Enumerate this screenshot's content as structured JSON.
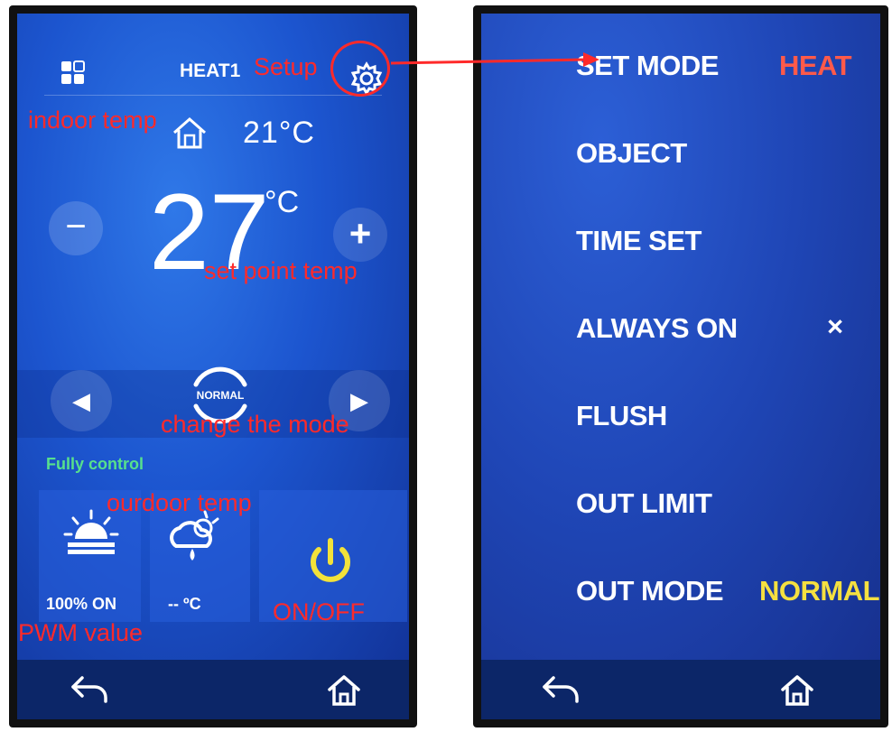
{
  "left_screen": {
    "title": "HEAT1",
    "indoor_temp": "21°C",
    "setpoint": "27",
    "setpoint_unit": "°C",
    "minus_label": "−",
    "plus_label": "+",
    "prev_label": "◀",
    "next_label": "▶",
    "mode": "NORMAL",
    "control_status": "Fully control",
    "pwm_text": "100%  ON",
    "outdoor_text": "--  ºC",
    "icons": [
      "grid-icon",
      "gear-icon",
      "house-icon",
      "sun-icon",
      "cloud-rain-icon",
      "power-icon",
      "back-icon",
      "home-icon"
    ]
  },
  "right_screen": {
    "menu": [
      {
        "label": "SET MODE",
        "value": "HEAT"
      },
      {
        "label": "OBJECT",
        "value": ""
      },
      {
        "label": "TIME SET",
        "value": ""
      },
      {
        "label": "ALWAYS ON",
        "value": "×"
      },
      {
        "label": "FLUSH",
        "value": ""
      },
      {
        "label": "OUT LIMIT",
        "value": ""
      },
      {
        "label": "OUT MODE",
        "value": "NORMAL"
      }
    ]
  },
  "annotations": {
    "setup": "Setup",
    "indoor": "indoor temp",
    "setpoint": "set point temp",
    "mode": "change the mode",
    "outdoor": "ourdoor temp",
    "onoff": "ON/OFF",
    "pwm": "PWM value"
  },
  "colors": {
    "accent_red": "#ff2a2a",
    "heat_value": "#ff5a4a",
    "normal_value": "#f5e040",
    "power_yellow": "#f2e23a",
    "status_green": "#57e08d"
  }
}
